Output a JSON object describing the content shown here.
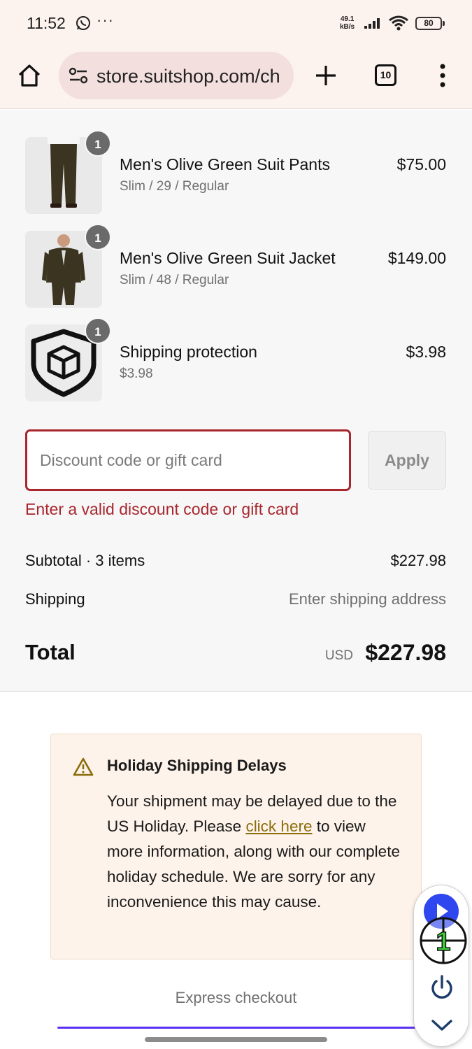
{
  "status_bar": {
    "time": "11:52",
    "dots": "···",
    "net_speed_value": "49.1",
    "net_speed_unit": "kB/s",
    "battery": "80"
  },
  "browser": {
    "url": "store.suitshop.com/ch",
    "tab_count": "10"
  },
  "cart": {
    "items": [
      {
        "name": "Men's Olive Green Suit Pants",
        "variant": "Slim / 29 / Regular",
        "price": "$75.00",
        "quantity": "1",
        "thumb": "pants-photo"
      },
      {
        "name": "Men's Olive Green Suit Jacket",
        "variant": "Slim / 48 / Regular",
        "price": "$149.00",
        "quantity": "1",
        "thumb": "jacket-photo"
      },
      {
        "name": "Shipping protection",
        "variant": "$3.98",
        "price": "$3.98",
        "quantity": "1",
        "thumb": "shield-box-icon"
      }
    ],
    "discount": {
      "placeholder": "Discount code or gift card",
      "value": "",
      "apply_label": "Apply",
      "error": "Enter a valid discount code or gift card",
      "error_color": "#a8262e"
    },
    "subtotal_label": "Subtotal · 3 items",
    "subtotal_value": "$227.98",
    "shipping_label": "Shipping",
    "shipping_value": "Enter shipping address",
    "total_label": "Total",
    "total_currency": "USD",
    "total_value": "$227.98"
  },
  "notice": {
    "title": "Holiday Shipping Delays",
    "body_before": "Your shipment may be delayed due to the US Holiday. Please ",
    "link_text": "click here",
    "body_after": " to view more information, along with our complete holiday schedule. We are sorry for any inconvenience this may cause.",
    "link_color": "#8b6d0b"
  },
  "express_checkout": {
    "label": "Express checkout",
    "accent_color": "#5a31f4"
  },
  "overlay_widget": {
    "counter": "1",
    "play_color": "#2f47ee"
  }
}
